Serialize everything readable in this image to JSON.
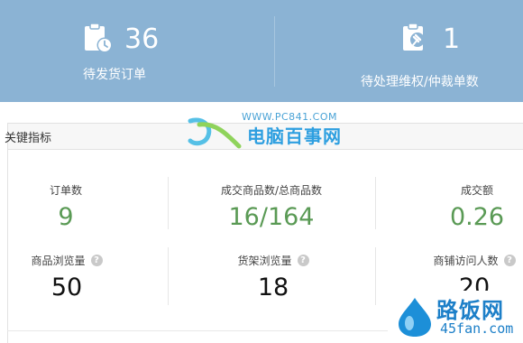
{
  "banner": {
    "pending_shipment": {
      "count": "36",
      "label": "待发货订单",
      "icon": "clipboard-clock-icon"
    },
    "pending_dispute": {
      "count": "1",
      "label": "待处理维权/仲裁单数",
      "icon": "clipboard-gavel-icon"
    }
  },
  "watermark": {
    "url": "WWW.PC841.COM",
    "title": "电脑百事网"
  },
  "section": {
    "title": "关键指标"
  },
  "metrics_row1": [
    {
      "label": "订单数",
      "value": "9"
    },
    {
      "label": "成交商品数/总商品数",
      "value": "16/164"
    },
    {
      "label": "成交额",
      "value": "0.26"
    }
  ],
  "metrics_row2": [
    {
      "label": "商品浏览量",
      "value": "50",
      "help": "?"
    },
    {
      "label": "货架浏览量",
      "value": "18",
      "help": "?"
    },
    {
      "label": "商铺访问人数",
      "value": "20",
      "help": "?"
    }
  ],
  "corner_logo": {
    "title": "路饭网",
    "sub": "45fan.com"
  },
  "colors": {
    "banner": "#8bb3d4",
    "green_value": "#5a9a55",
    "dark_value": "#111111"
  }
}
